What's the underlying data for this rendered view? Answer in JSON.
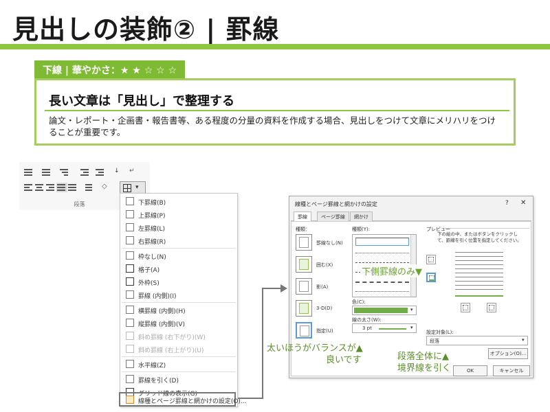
{
  "slide": {
    "title": "見出しの装飾② | 罫線",
    "tag": "下線 | 華やかさ：★ ★ ☆ ☆ ☆",
    "heading": "長い文章は「見出し」で整理する",
    "body": "論文・レポート・企画書・報告書等、ある程度の分量の資料を作成する場合、見出しをつけて文章にメリハリをつけることが重要です。"
  },
  "ribbon": {
    "group_label": "段落"
  },
  "menu": {
    "items": [
      {
        "label": "下罫線(B)"
      },
      {
        "label": "上罫線(P)"
      },
      {
        "label": "左罫線(L)"
      },
      {
        "label": "右罫線(R)"
      },
      {
        "label": "枠なし(N)"
      },
      {
        "label": "格子(A)"
      },
      {
        "label": "外枠(S)"
      },
      {
        "label": "罫線 (内側)(I)"
      },
      {
        "label": "横罫線 (内側)(H)"
      },
      {
        "label": "縦罫線 (内側)(V)"
      },
      {
        "label": "斜め罫線 (右下がり)(W)"
      },
      {
        "label": "斜め罫線 (右上がり)(U)"
      },
      {
        "label": "水平線(Z)"
      },
      {
        "label": "罫線を引く(D)"
      },
      {
        "label": "グリッド線の表示(G)"
      },
      {
        "label": "線種とページ罫線と網かけの設定(O)..."
      }
    ]
  },
  "dialog": {
    "title": "線種とページ罫線と網かけの設定",
    "help": "?",
    "close": "✕",
    "tabs": [
      "罫線",
      "ページ罫線",
      "網かけ"
    ],
    "settings_label": "種類：",
    "settings": [
      "罫線なし(N)",
      "囲む(X)",
      "影(A)",
      "3-D(D)",
      "指定(U)"
    ],
    "style_label": "種類(Y):",
    "color_label": "色(C):",
    "width_label": "線の太さ(W):",
    "width_value": "3 pt",
    "preview_label": "プレビュー",
    "preview_desc": "下の絵の中、またはボタンをクリックして、罫線を引く位置を指定してください。",
    "apply_label": "設定対象(L):",
    "apply_value": "段落",
    "options_button": "オプション(O)...",
    "ok_button": "OK",
    "cancel_button": "キャンセル"
  },
  "annotations": {
    "bottom_only": "下側罫線のみ▼",
    "thick_balance_1": "太いほうがバランスが▲",
    "thick_balance_2": "良いです",
    "whole_para_1": "段落全体に▲",
    "whole_para_2": "境界線を引く"
  },
  "colors": {
    "accent": "#8dc63f",
    "accent_dark": "#7fba34",
    "line_green": "#70ad47",
    "annotation": "#5a8e2a"
  }
}
